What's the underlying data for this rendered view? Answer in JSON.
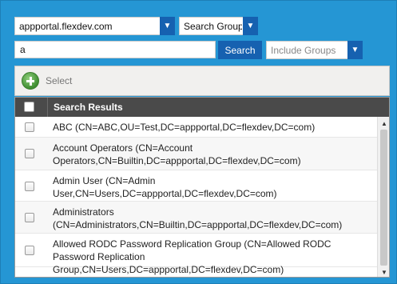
{
  "filters": {
    "domain_value": "appportal.flexdev.com",
    "search_type_value": "Search Group",
    "search_query": "a",
    "search_button_label": "Search",
    "include_value": "Include Groups"
  },
  "toolbar": {
    "select_label": "Select"
  },
  "grid": {
    "header_title": "Search Results",
    "rows": [
      {
        "text": "ABC (CN=ABC,OU=Test,DC=appportal,DC=flexdev,DC=com)"
      },
      {
        "text": "Account Operators (CN=Account Operators,CN=Builtin,DC=appportal,DC=flexdev,DC=com)"
      },
      {
        "text": "Admin User (CN=Admin User,CN=Users,DC=appportal,DC=flexdev,DC=com)"
      },
      {
        "text": "Administrators (CN=Administrators,CN=Builtin,DC=appportal,DC=flexdev,DC=com)"
      },
      {
        "text": "Allowed RODC Password Replication Group (CN=Allowed RODC Password Replication Group,CN=Users,DC=appportal,DC=flexdev,DC=com)"
      }
    ]
  },
  "colors": {
    "panel_bg": "#2596d4",
    "button_blue": "#1661b0",
    "grid_header": "#4a4a4a"
  },
  "icons": {
    "dropdown": "caret-down-icon",
    "add": "plus-circle-icon"
  }
}
